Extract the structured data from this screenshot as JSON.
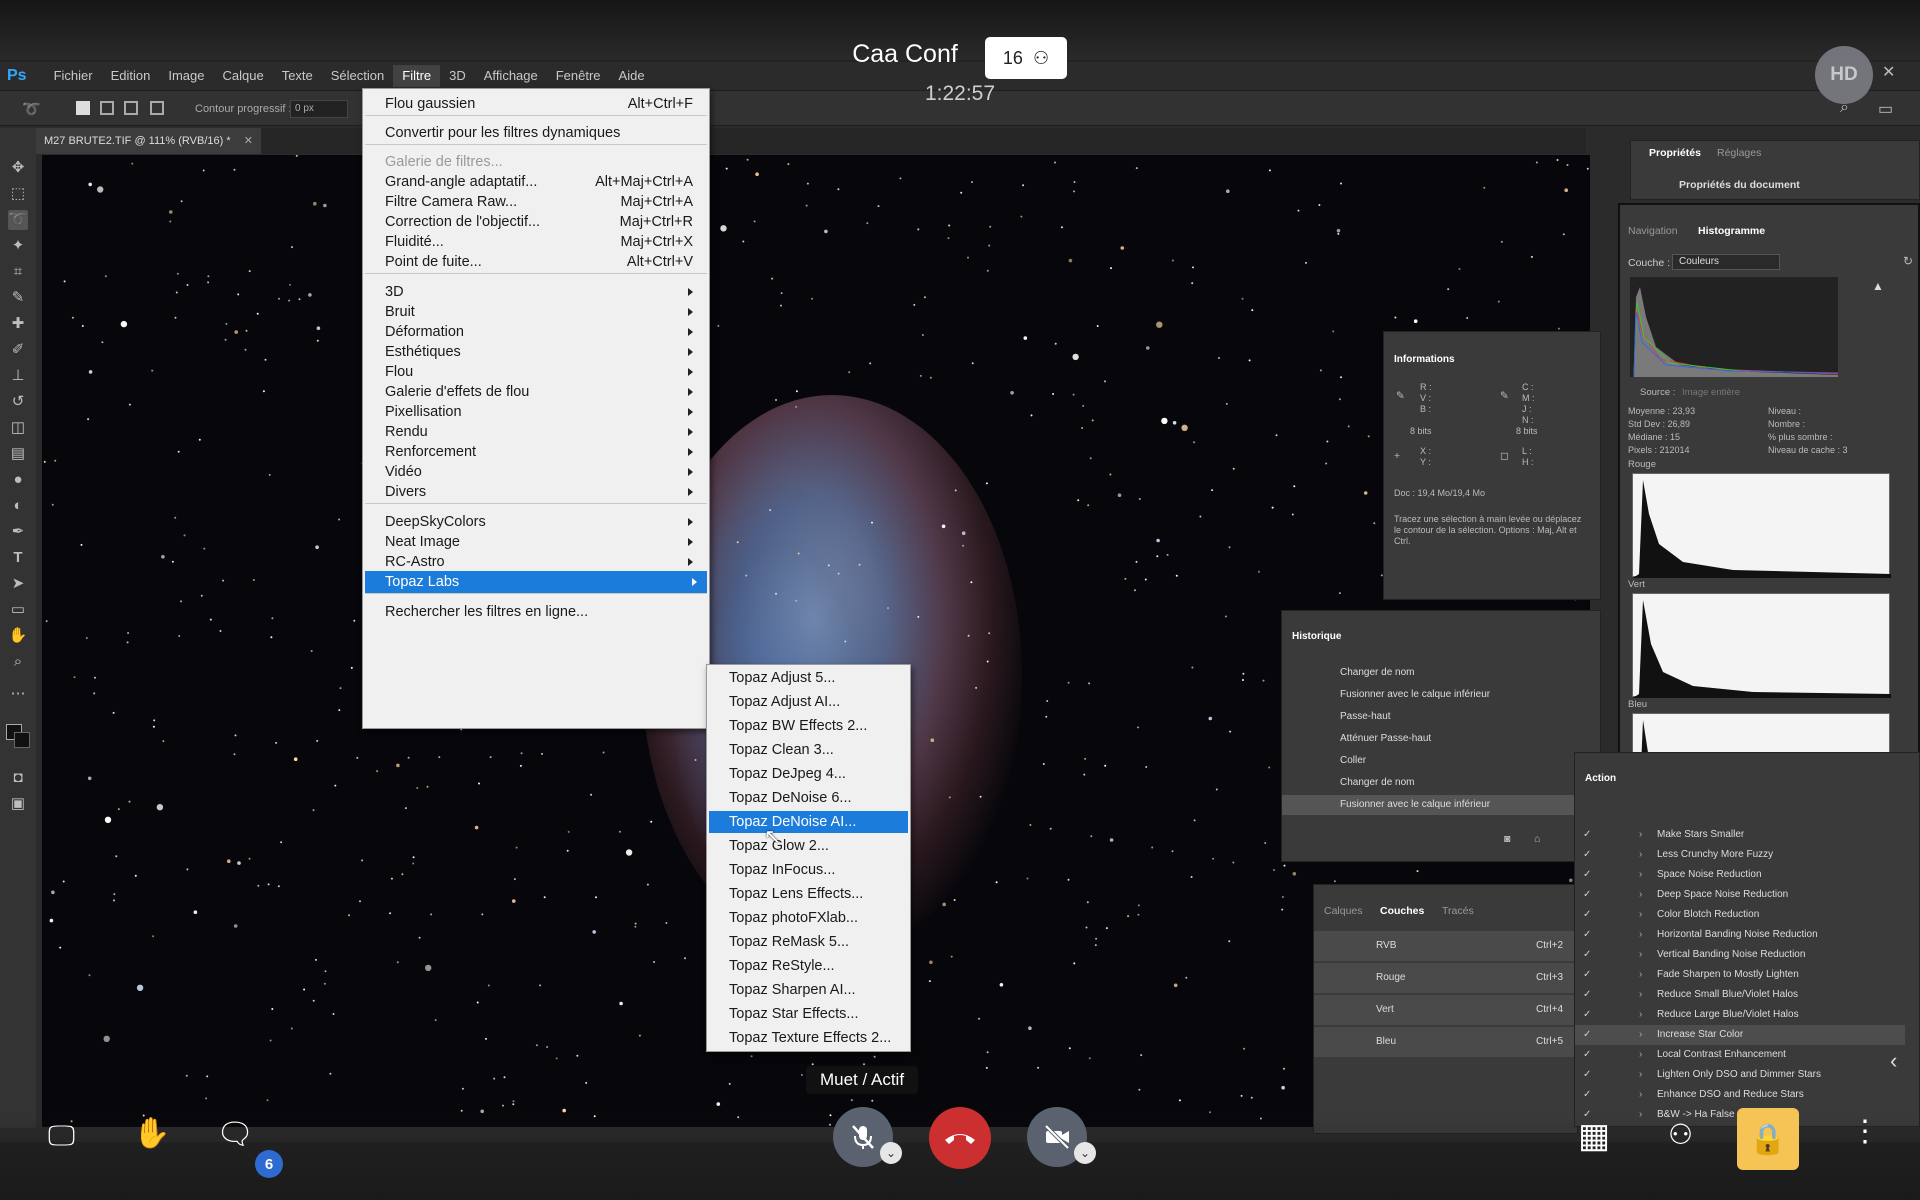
{
  "conference": {
    "title": "Caa Conf",
    "participant_count": "16",
    "elapsed": "1:22:57",
    "avatar_initials": "HD",
    "mute_tooltip": "Muet / Actif",
    "chat_unread": "6"
  },
  "photoshop": {
    "logo": "Ps",
    "menubar": [
      "Fichier",
      "Edition",
      "Image",
      "Calque",
      "Texte",
      "Sélection",
      "Filtre",
      "3D",
      "Affichage",
      "Fenêtre",
      "Aide"
    ],
    "active_menu": "Filtre",
    "options": {
      "feather_label": "Contour progressif :",
      "feather_value": "0 px"
    },
    "document_tab": "M27 BRUTE2.TIF @ 111% (RVB/16) *",
    "filter_menu": [
      {
        "label": "Flou gaussien",
        "shortcut": "Alt+Ctrl+F"
      },
      {
        "label": "Convertir pour les filtres dynamiques",
        "shortcut": ""
      },
      {
        "label": "Galerie de filtres...",
        "shortcut": "",
        "disabled": true
      },
      {
        "label": "Grand-angle adaptatif...",
        "shortcut": "Alt+Maj+Ctrl+A"
      },
      {
        "label": "Filtre Camera Raw...",
        "shortcut": "Maj+Ctrl+A"
      },
      {
        "label": "Correction de l'objectif...",
        "shortcut": "Maj+Ctrl+R"
      },
      {
        "label": "Fluidité...",
        "shortcut": "Maj+Ctrl+X"
      },
      {
        "label": "Point de fuite...",
        "shortcut": "Alt+Ctrl+V"
      },
      {
        "label": "3D",
        "submenu": true
      },
      {
        "label": "Bruit",
        "submenu": true
      },
      {
        "label": "Déformation",
        "submenu": true
      },
      {
        "label": "Esthétiques",
        "submenu": true
      },
      {
        "label": "Flou",
        "submenu": true
      },
      {
        "label": "Galerie d'effets de flou",
        "submenu": true
      },
      {
        "label": "Pixellisation",
        "submenu": true
      },
      {
        "label": "Rendu",
        "submenu": true
      },
      {
        "label": "Renforcement",
        "submenu": true
      },
      {
        "label": "Vidéo",
        "submenu": true
      },
      {
        "label": "Divers",
        "submenu": true
      },
      {
        "label": "DeepSkyColors",
        "submenu": true
      },
      {
        "label": "Neat Image",
        "submenu": true
      },
      {
        "label": "RC-Astro",
        "submenu": true
      },
      {
        "label": "Topaz Labs",
        "submenu": true,
        "highlighted": true
      },
      {
        "label": "Rechercher les filtres en ligne...",
        "shortcut": ""
      }
    ],
    "topaz_menu": [
      "Topaz Adjust 5...",
      "Topaz Adjust AI...",
      "Topaz BW Effects 2...",
      "Topaz Clean 3...",
      "Topaz DeJpeg 4...",
      "Topaz DeNoise 6...",
      "Topaz DeNoise AI...",
      "Topaz Glow 2...",
      "Topaz InFocus...",
      "Topaz Lens Effects...",
      "Topaz photoFXlab...",
      "Topaz ReMask 5...",
      "Topaz ReStyle...",
      "Topaz Sharpen AI...",
      "Topaz Star Effects...",
      "Topaz Texture Effects 2..."
    ],
    "topaz_highlighted": "Topaz DeNoise AI...",
    "properties": {
      "tabs": [
        "Propriétés",
        "Réglages"
      ],
      "content": "Propriétés du document"
    },
    "histogram": {
      "tabs": [
        "Navigation",
        "Histogramme"
      ],
      "channel_label": "Couche :",
      "channel_value": "Couleurs",
      "source_label": "Source :",
      "source_value": "Image entière",
      "stats_left": [
        [
          "Moyenne :",
          "23,93"
        ],
        [
          "Std Dev :",
          "26,89"
        ],
        [
          "Médiane :",
          "15"
        ],
        [
          "Pixels :",
          "212014"
        ]
      ],
      "stats_right": [
        "Niveau :",
        "Nombre :",
        "% plus sombre :",
        "Niveau de cache : 3"
      ],
      "channels": [
        "Rouge",
        "Vert",
        "Bleu"
      ]
    },
    "info": {
      "title": "Informations",
      "rgb": "R :\nV :\nB :",
      "cmyk": "C :\nM :\nJ :\nN :",
      "bits_left": "8 bits",
      "bits_right": "8 bits",
      "xy": "X :\nY :",
      "lh": "L :\nH :",
      "doc": "Doc : 19,4 Mo/19,4 Mo",
      "hint": "Tracez une sélection à main levée ou déplacez le contour de la sélection. Options : Maj, Alt et Ctrl."
    },
    "history": {
      "title": "Historique",
      "items": [
        "Changer de nom",
        "Fusionner avec le calque inférieur",
        "Passe-haut",
        "Atténuer Passe-haut",
        "Coller",
        "Changer de nom",
        "Fusionner avec le calque inférieur"
      ]
    },
    "layers": {
      "tabs": [
        "Calques",
        "Couches",
        "Tracés"
      ],
      "channels": [
        [
          "RVB",
          "Ctrl+2"
        ],
        [
          "Rouge",
          "Ctrl+3"
        ],
        [
          "Vert",
          "Ctrl+4"
        ],
        [
          "Bleu",
          "Ctrl+5"
        ]
      ]
    },
    "actions": {
      "title": "Action",
      "items": [
        "Make Stars Smaller",
        "Less Crunchy More Fuzzy",
        "Space Noise Reduction",
        "Deep Space Noise Reduction",
        "Color Blotch Reduction",
        "Horizontal Banding Noise Reduction",
        "Vertical Banding Noise Reduction",
        "Fade Sharpen to Mostly Lighten",
        "Reduce Small Blue/Violet Halos",
        "Reduce Large Blue/Violet Halos",
        "Increase Star Color",
        "Local Contrast Enhancement",
        "Lighten Only DSO and Dimmer Stars",
        "Enhance DSO and Reduce Stars",
        "B&W -> Ha False Color"
      ]
    },
    "status": "Doc : 19,4 Mo/19,4 Mo"
  },
  "colors": {
    "menu_highlight": "#1c7cdb",
    "hangup": "#cc2f2f",
    "lock": "#f6c355",
    "badge": "#2f6ad0"
  }
}
